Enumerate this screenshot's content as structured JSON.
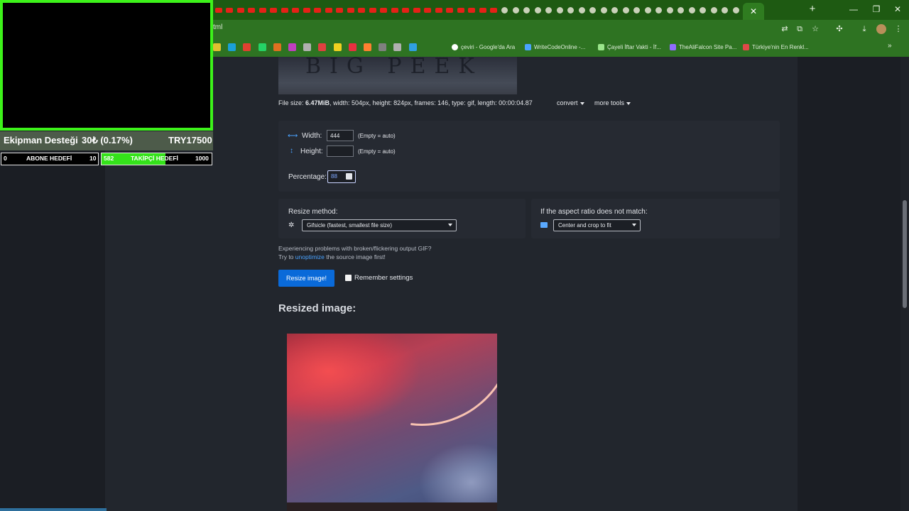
{
  "browser": {
    "url_fragment": "tml",
    "active_tab_close": "✕",
    "new_tab": "+",
    "window_controls": [
      "—",
      "❐",
      "✕"
    ],
    "bookmarks": [
      {
        "label": "çeviri - Google'da Ara",
        "icon_color": "#ffffff"
      },
      {
        "label": "WriteCodeOnline -...",
        "icon_color": "#4aa3ff"
      },
      {
        "label": "Çayeli İftar Vakti - İf...",
        "icon_color": "#9be58b"
      },
      {
        "label": "TheAliFalcon Site Pa...",
        "icon_color": "#8f6cff"
      },
      {
        "label": "Türkiye'nin En Renkl...",
        "icon_color": "#e04848"
      }
    ],
    "bookmarks_more": "»"
  },
  "stream_overlay": {
    "support_label": "Ekipman Desteği",
    "support_amount": "30₺ (0.17%)",
    "support_target": "TRY17500",
    "goals": [
      {
        "start": "0",
        "label": "ABONE HEDEFİ",
        "target": "10",
        "progress": 0.0
      },
      {
        "start": "582",
        "label": "TAKİPÇİ HEDEFİ",
        "target": "1000",
        "progress": 0.582
      }
    ]
  },
  "page": {
    "preview_text": "BIG PEEK",
    "file_info": {
      "prefix": "File size: ",
      "size": "6.47MiB",
      "rest": ", width: 504px, height: 824px, frames: 146, type: gif, length: 00:00:04.87"
    },
    "convert_label": "convert",
    "more_tools_label": "more tools",
    "width_label": "Width:",
    "width_value": "444",
    "height_label": "Height:",
    "height_value": "",
    "empty_auto": "(Empty = auto)",
    "percentage_label": "Percentage:",
    "percentage_value": "88",
    "resize_method_label": "Resize method:",
    "resize_method_value": "Gifsicle (fastest, smallest file size)",
    "aspect_label": "If the aspect ratio does not match:",
    "aspect_value": "Center and crop to fit",
    "hint_line1": "Experiencing problems with broken/flickering output GIF?",
    "hint_try": "Try to ",
    "hint_link": "unoptimize",
    "hint_rest": " the source image first!",
    "resize_button": "Resize image!",
    "remember_label": "Remember settings",
    "resized_heading": "Resized image:"
  },
  "colors": {
    "chrome_green": "#2e7322",
    "overlay_green": "#3df31a",
    "accent_blue": "#0a6ad9",
    "link_blue": "#4aa3ff"
  }
}
